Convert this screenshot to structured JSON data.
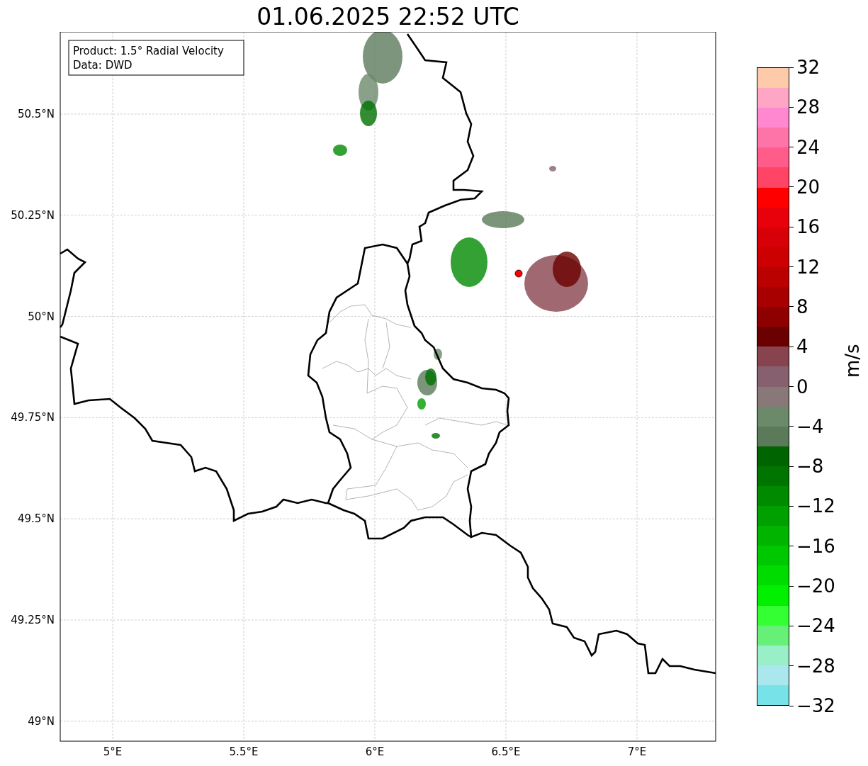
{
  "title": "01.06.2025 22:52 UTC",
  "info_box": [
    "Product: 1.5° Radial Velocity",
    "Data: DWD"
  ],
  "map": {
    "y_ticks": [
      "50.5°N",
      "50.25°N",
      "50°N",
      "49.75°N",
      "49.5°N",
      "49.25°N",
      "49°N"
    ],
    "x_ticks": [
      "5°E",
      "5.5°E",
      "6°E",
      "6.5°E",
      "7°E"
    ]
  },
  "colorbar": {
    "label": "m/s",
    "ticks": [
      "32",
      "28",
      "24",
      "20",
      "16",
      "12",
      "8",
      "4",
      "0",
      "−4",
      "−8",
      "−12",
      "−16",
      "−20",
      "−24",
      "−28",
      "−32"
    ],
    "segments": [
      {
        "color": "#fecbaa"
      },
      {
        "color": "#ffa6c6"
      },
      {
        "color": "#ff88d0"
      },
      {
        "color": "#ff74a8"
      },
      {
        "color": "#ff5c8a"
      },
      {
        "color": "#ff4466"
      },
      {
        "color": "#ff0000"
      },
      {
        "color": "#e8000a"
      },
      {
        "color": "#d80008"
      },
      {
        "color": "#cc0000"
      },
      {
        "color": "#bb0000"
      },
      {
        "color": "#a80000"
      },
      {
        "color": "#8e0000"
      },
      {
        "color": "#6b0000"
      },
      {
        "color": "#88444e"
      },
      {
        "color": "#86606e"
      },
      {
        "color": "#887878"
      },
      {
        "color": "#6a8a6a"
      },
      {
        "color": "#5a7a5a"
      },
      {
        "color": "#006400"
      },
      {
        "color": "#007400"
      },
      {
        "color": "#008a00"
      },
      {
        "color": "#00a000"
      },
      {
        "color": "#00b400"
      },
      {
        "color": "#00c800"
      },
      {
        "color": "#00dc00"
      },
      {
        "color": "#00f000"
      },
      {
        "color": "#33ff33"
      },
      {
        "color": "#66f077"
      },
      {
        "color": "#99f0c8"
      },
      {
        "color": "#aae8ee"
      },
      {
        "color": "#77e2e8"
      }
    ]
  }
}
